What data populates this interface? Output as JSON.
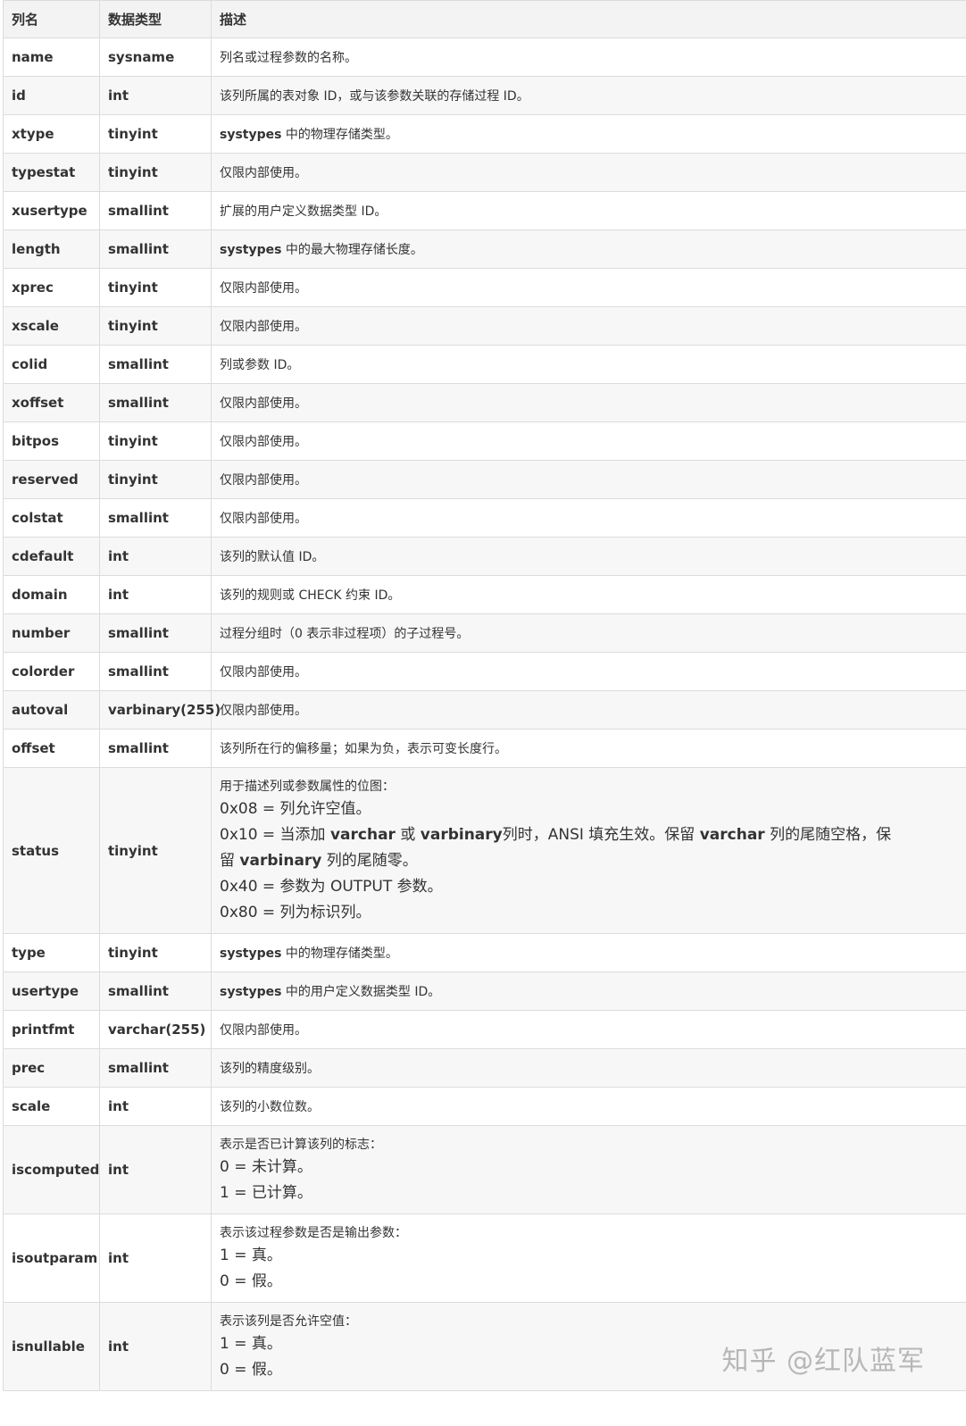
{
  "table": {
    "headers": [
      "列名",
      "数据类型",
      "描述"
    ],
    "rows": [
      {
        "name": "name",
        "type": "sysname",
        "desc": [
          {
            "t": "列名或过程参数的名称。"
          }
        ]
      },
      {
        "name": "id",
        "type": "int",
        "desc": [
          {
            "t": "该列所属的表对象 ID，或与该参数关联的存储过程 ID。"
          }
        ]
      },
      {
        "name": "xtype",
        "type": "tinyint",
        "desc": [
          {
            "t": "systypes",
            "b": true
          },
          {
            "t": " 中的物理存储类型。"
          }
        ]
      },
      {
        "name": "typestat",
        "type": "tinyint",
        "desc": [
          {
            "t": "仅限内部使用。"
          }
        ]
      },
      {
        "name": "xusertype",
        "type": "smallint",
        "desc": [
          {
            "t": "扩展的用户定义数据类型 ID。"
          }
        ]
      },
      {
        "name": "length",
        "type": "smallint",
        "desc": [
          {
            "t": "systypes",
            "b": true
          },
          {
            "t": " 中的最大物理存储长度。"
          }
        ]
      },
      {
        "name": "xprec",
        "type": "tinyint",
        "desc": [
          {
            "t": "仅限内部使用。"
          }
        ]
      },
      {
        "name": "xscale",
        "type": "tinyint",
        "desc": [
          {
            "t": "仅限内部使用。"
          }
        ]
      },
      {
        "name": "colid",
        "type": "smallint",
        "desc": [
          {
            "t": "列或参数 ID。"
          }
        ]
      },
      {
        "name": "xoffset",
        "type": "smallint",
        "desc": [
          {
            "t": "仅限内部使用。"
          }
        ]
      },
      {
        "name": "bitpos",
        "type": "tinyint",
        "desc": [
          {
            "t": "仅限内部使用。"
          }
        ]
      },
      {
        "name": "reserved",
        "type": "tinyint",
        "desc": [
          {
            "t": "仅限内部使用。"
          }
        ]
      },
      {
        "name": "colstat",
        "type": "smallint",
        "desc": [
          {
            "t": "仅限内部使用。"
          }
        ]
      },
      {
        "name": "cdefault",
        "type": "int",
        "desc": [
          {
            "t": "该列的默认值 ID。"
          }
        ]
      },
      {
        "name": "domain",
        "type": "int",
        "desc": [
          {
            "t": "该列的规则或 CHECK 约束 ID。"
          }
        ]
      },
      {
        "name": "number",
        "type": "smallint",
        "desc": [
          {
            "t": "过程分组时（0 表示非过程项）的子过程号。"
          }
        ]
      },
      {
        "name": "colorder",
        "type": "smallint",
        "desc": [
          {
            "t": "仅限内部使用。"
          }
        ]
      },
      {
        "name": "autoval",
        "type": "varbinary(255)",
        "desc": [
          {
            "t": "仅限内部使用。"
          }
        ]
      },
      {
        "name": "offset",
        "type": "smallint",
        "desc": [
          {
            "t": "该列所在行的偏移量；如果为负，表示可变长度行。"
          }
        ]
      },
      {
        "name": "status",
        "type": "tinyint",
        "multi": true,
        "intro": "用于描述列或参数属性的位图：",
        "lines": [
          [
            {
              "t": "0x08 = 列允许空值。"
            }
          ],
          [
            {
              "t": "0x10 = 当添加 "
            },
            {
              "t": "varchar",
              "b": true
            },
            {
              "t": " 或 "
            },
            {
              "t": "varbinary",
              "b": true
            },
            {
              "t": "列时，ANSI 填充生效。保留 "
            },
            {
              "t": "varchar",
              "b": true
            },
            {
              "t": " 列的尾随空格，保"
            }
          ],
          [
            {
              "t": "留 "
            },
            {
              "t": "varbinary",
              "b": true
            },
            {
              "t": " 列的尾随零。"
            }
          ],
          [
            {
              "t": "0x40 = 参数为 OUTPUT 参数。"
            }
          ],
          [
            {
              "t": "0x80 = 列为标识列。"
            }
          ]
        ]
      },
      {
        "name": "type",
        "type": "tinyint",
        "desc": [
          {
            "t": "systypes",
            "b": true
          },
          {
            "t": " 中的物理存储类型。"
          }
        ]
      },
      {
        "name": "usertype",
        "type": "smallint",
        "desc": [
          {
            "t": "systypes",
            "b": true
          },
          {
            "t": " 中的用户定义数据类型 ID。"
          }
        ]
      },
      {
        "name": "printfmt",
        "type": "varchar(255)",
        "desc": [
          {
            "t": "仅限内部使用。"
          }
        ]
      },
      {
        "name": "prec",
        "type": "smallint",
        "desc": [
          {
            "t": "该列的精度级别。"
          }
        ]
      },
      {
        "name": "scale",
        "type": "int",
        "desc": [
          {
            "t": "该列的小数位数。"
          }
        ]
      },
      {
        "name": "iscomputed",
        "type": "int",
        "multi": true,
        "intro": "表示是否已计算该列的标志：",
        "lines": [
          [
            {
              "t": "0 = 未计算。"
            }
          ],
          [
            {
              "t": "1 = 已计算。"
            }
          ]
        ]
      },
      {
        "name": "isoutparam",
        "type": "int",
        "multi": true,
        "intro": "表示该过程参数是否是输出参数：",
        "lines": [
          [
            {
              "t": "1 = 真。"
            }
          ],
          [
            {
              "t": "0 = 假。"
            }
          ]
        ]
      },
      {
        "name": "isnullable",
        "type": "int",
        "multi": true,
        "intro": "表示该列是否允许空值：",
        "lines": [
          [
            {
              "t": "1 = 真。"
            }
          ],
          [
            {
              "t": "0 = 假。"
            }
          ]
        ]
      }
    ]
  },
  "watermark": "知乎 @红队蓝军"
}
